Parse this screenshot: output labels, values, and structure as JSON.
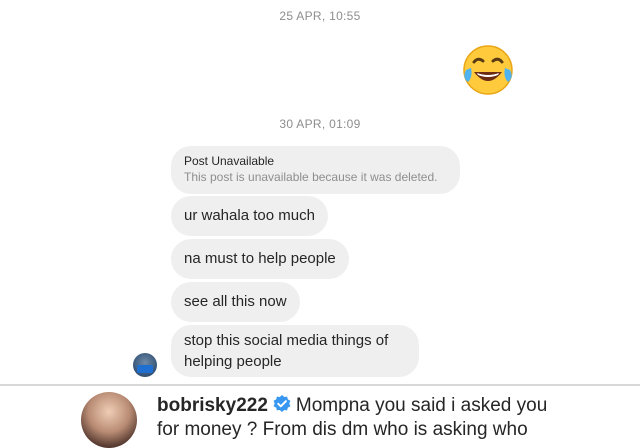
{
  "thread": {
    "timestamp_1": "25 APR, 10:55",
    "emoji_icon": "face-with-tears-of-joy",
    "timestamp_2": "30 APR, 01:09",
    "shared_post": {
      "title": "Post Unavailable",
      "subtitle": "This post is unavailable because it was deleted."
    },
    "messages": [
      "ur wahala too much",
      "na must to help people",
      "see all this now",
      "stop this social media things of helping people"
    ]
  },
  "comment": {
    "username": "bobrisky222",
    "verified": true,
    "text_line_1": "Mompna you said i asked you",
    "text_line_2": "for money ? From dis dm who is asking who"
  },
  "colors": {
    "bubble_bg": "#efefef",
    "timestamp": "#8e8e8e",
    "verified_blue": "#3897f0"
  }
}
